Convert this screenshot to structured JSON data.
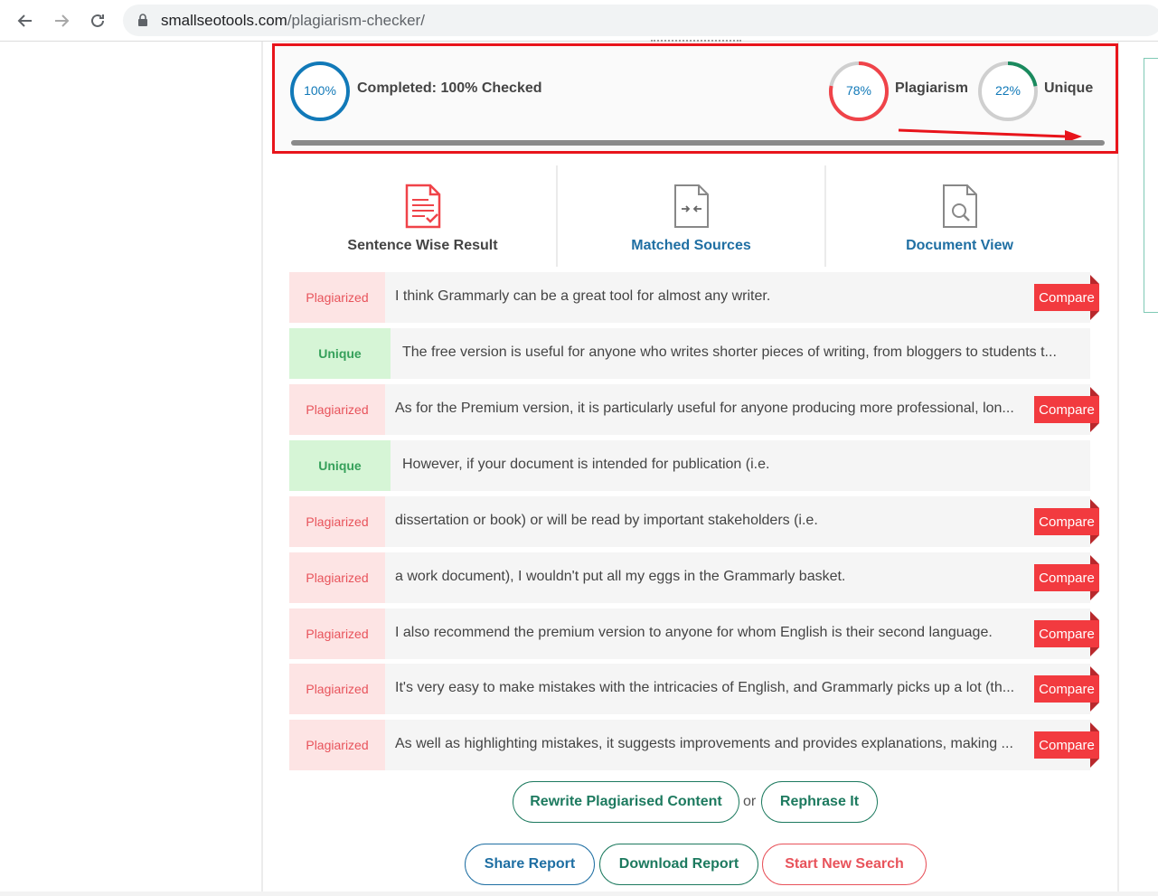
{
  "browser": {
    "url_domain": "smallseotools.com",
    "url_path": "/plagiarism-checker/"
  },
  "summary": {
    "completed_pct": "100%",
    "completed_label": "Completed: 100% Checked",
    "plagiarism_pct": "78%",
    "plagiarism_fraction": 0.78,
    "plagiarism_label": "Plagiarism",
    "unique_pct": "22%",
    "unique_fraction": 0.22,
    "unique_label": "Unique",
    "colors": {
      "completed": "#1179b8",
      "plagiarism": "#f04349",
      "unique": "#1a8a5e",
      "ring_track": "#cfcfcf"
    }
  },
  "tabs": [
    {
      "label": "Sentence Wise Result",
      "icon": "document-check-icon"
    },
    {
      "label": "Matched Sources",
      "icon": "document-compare-icon"
    },
    {
      "label": "Document View",
      "icon": "document-search-icon"
    }
  ],
  "results": [
    {
      "status": "Plagiarized",
      "text": "I think Grammarly can be a great tool for almost any writer.",
      "compare": "Compare"
    },
    {
      "status": "Unique",
      "text": "The free version is useful for anyone who writes shorter pieces of writing, from bloggers to students t...",
      "compare": ""
    },
    {
      "status": "Plagiarized",
      "text": "As for the Premium version, it is particularly useful for anyone producing more professional, lon...",
      "compare": "Compare"
    },
    {
      "status": "Unique",
      "text": "However, if your document is intended for publication (i.e.",
      "compare": ""
    },
    {
      "status": "Plagiarized",
      "text": "dissertation or book) or will be read by important stakeholders (i.e.",
      "compare": "Compare"
    },
    {
      "status": "Plagiarized",
      "text": "a work document), I wouldn't put all my eggs in the Grammarly basket.",
      "compare": "Compare"
    },
    {
      "status": "Plagiarized",
      "text": "I also recommend the premium version to anyone for whom English is their second language.",
      "compare": "Compare"
    },
    {
      "status": "Plagiarized",
      "text": "It's very easy to make mistakes with the intricacies of English, and Grammarly picks up a lot (th...",
      "compare": "Compare"
    },
    {
      "status": "Plagiarized",
      "text": "As well as highlighting mistakes, it suggests improvements and provides explanations, making ...",
      "compare": "Compare"
    }
  ],
  "actions": {
    "rewrite": "Rewrite Plagiarised Content",
    "or": "or",
    "rephrase": "Rephrase It",
    "share": "Share Report",
    "download": "Download Report",
    "new_search": "Start New Search"
  }
}
